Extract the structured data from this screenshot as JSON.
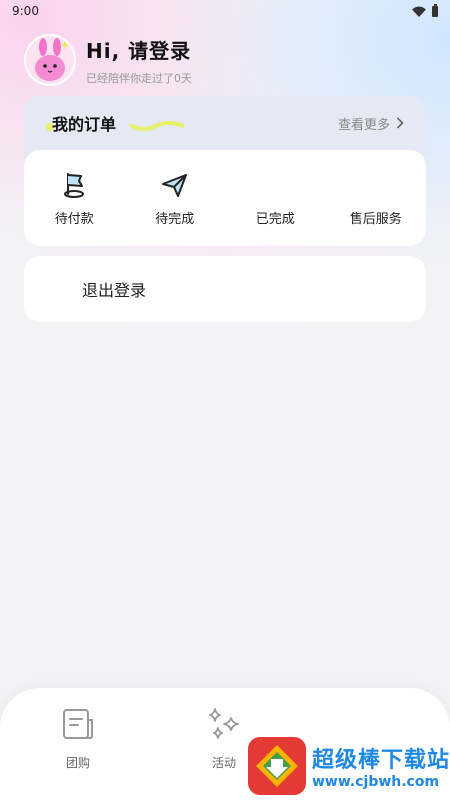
{
  "status_bar": {
    "time": "9:00"
  },
  "profile": {
    "greeting": "Hi, 请登录",
    "subtitle": "已经陪伴你走过了0天"
  },
  "orders": {
    "title": "我的订单",
    "more": "查看更多",
    "items": [
      {
        "label": "待付款",
        "icon": "flag-icon"
      },
      {
        "label": "待完成",
        "icon": "paper-plane-icon"
      },
      {
        "label": "已完成",
        "icon": ""
      },
      {
        "label": "售后服务",
        "icon": ""
      }
    ]
  },
  "logout": {
    "label": "退出登录"
  },
  "tabbar": {
    "items": [
      {
        "label": "团购",
        "icon": "notebook-icon"
      },
      {
        "label": "活动",
        "icon": "sparkles-icon"
      }
    ]
  },
  "watermark": {
    "title": "超级棒下载站",
    "url": "www.cjbwh.com"
  },
  "colors": {
    "accent_blue": "#1e88e5",
    "highlight_yellow": "#e8f06a",
    "background": "#f3f3f6"
  }
}
